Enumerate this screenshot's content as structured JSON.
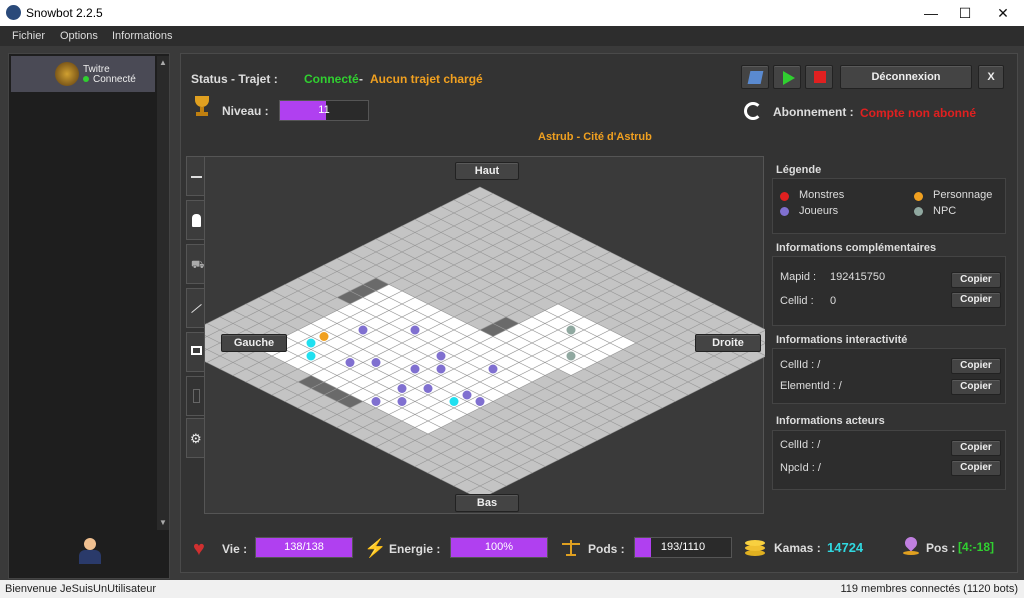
{
  "window": {
    "title": "Snowbot 2.2.5",
    "minimize": "—",
    "maximize": "☐",
    "close": "✕"
  },
  "menu": [
    "Fichier",
    "Options",
    "Informations"
  ],
  "account": {
    "name": "Twitre",
    "status": "Connecté"
  },
  "header": {
    "status_label": "Status - Trajet :",
    "status_value": "Connecté",
    "sep": "-",
    "trajet_value": "Aucun trajet chargé",
    "level_label": "Niveau :",
    "level_value": "11",
    "level_fraction": 0.52,
    "deconnexion": "Déconnexion",
    "x_btn": "X",
    "abonnement_label": "Abonnement :",
    "abonnement_value": "Compte non abonné"
  },
  "map": {
    "location": "Astrub - Cité d'Astrub",
    "haut": "Haut",
    "bas": "Bas",
    "gauche": "Gauche",
    "droite": "Droite"
  },
  "legend": {
    "title": "Légende",
    "monstres": "Monstres",
    "personnage": "Personnage",
    "joueurs": "Joueurs",
    "npc": "NPC",
    "colors": {
      "monstres": "#e02020",
      "personnage": "#f0a020",
      "joueurs": "#8070d0",
      "npc": "#90a8a0"
    }
  },
  "info_comp": {
    "title": "Informations complémentaires",
    "mapid_label": "Mapid :",
    "mapid_value": "192415750",
    "cellid_label": "Cellid :",
    "cellid_value": "0",
    "copy": "Copier"
  },
  "info_inter": {
    "title": "Informations interactivité",
    "cellid": "CellId : /",
    "elementid": "ElementId : /",
    "copy": "Copier"
  },
  "info_act": {
    "title": "Informations acteurs",
    "cellid": "CellId : /",
    "npcid": "NpcId : /",
    "copy": "Copier"
  },
  "footer": {
    "vie_label": "Vie :",
    "vie_value": "138/138",
    "vie_fraction": 1.0,
    "energie_label": "Energie :",
    "energie_value": "100%",
    "energie_fraction": 1.0,
    "pods_label": "Pods :",
    "pods_value": "193/1110",
    "pods_fraction": 0.17,
    "kamas_label": "Kamas :",
    "kamas_value": "14724",
    "pos_label": "Pos :",
    "pos_value": "[4:-18]"
  },
  "statusbar": {
    "left": "Bienvenue JeSuisUnUtilisateur",
    "right": "119 membres connectés (1120 bots)"
  }
}
